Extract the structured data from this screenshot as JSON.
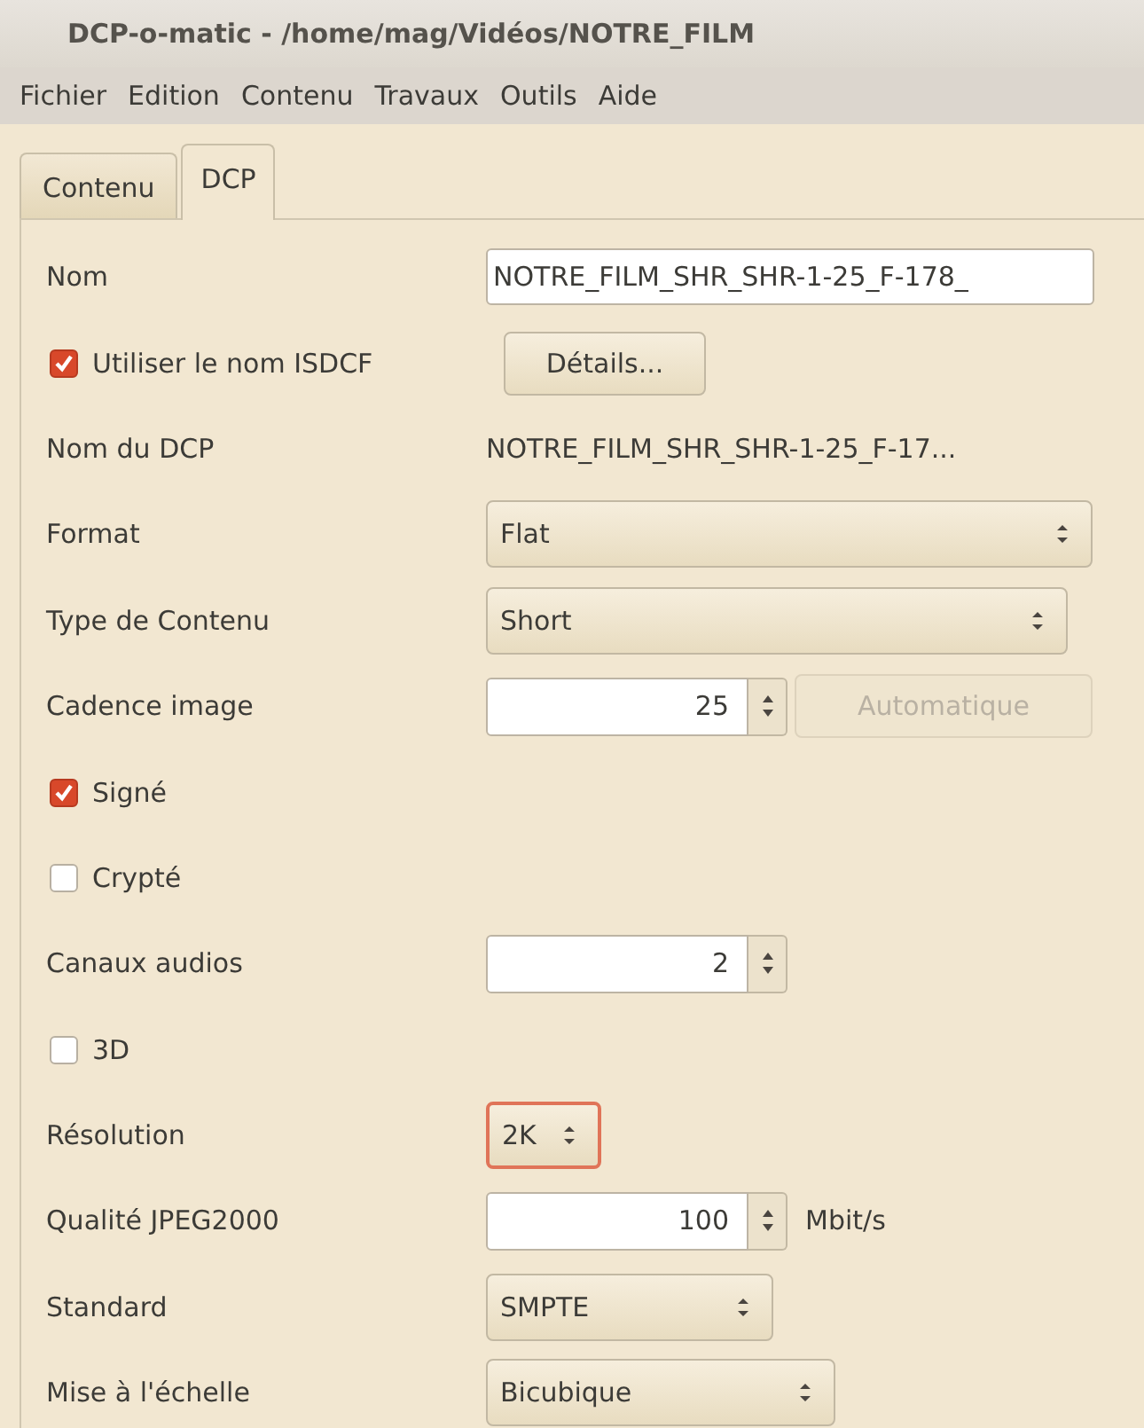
{
  "window": {
    "title": "DCP-o-matic - /home/mag/Vidéos/NOTRE_FILM"
  },
  "menu": [
    "Fichier",
    "Edition",
    "Contenu",
    "Travaux",
    "Outils",
    "Aide"
  ],
  "tabs": [
    {
      "label": "Contenu",
      "selected": false
    },
    {
      "label": "DCP",
      "selected": true
    }
  ],
  "rows": [
    {
      "kind": "text",
      "label": "Nom",
      "value": "NOTRE_FILM_SHR_SHR-1-25_F-178_"
    },
    {
      "kind": "checkbutton",
      "label": "Utiliser le nom ISDCF",
      "checked": true,
      "button": "Détails..."
    },
    {
      "kind": "readout",
      "label": "Nom du DCP",
      "value": "NOTRE_FILM_SHR_SHR-1-25_F-17..."
    },
    {
      "kind": "select",
      "label": "Format",
      "value": "Flat",
      "focused": false
    },
    {
      "kind": "select",
      "label": "Type de Contenu",
      "value": "Short",
      "focused": false
    },
    {
      "kind": "spin",
      "label": "Cadence image",
      "value": "25",
      "button": "Automatique",
      "disabled": true
    },
    {
      "kind": "checkbox",
      "label": "Signé",
      "checked": true
    },
    {
      "kind": "checkbox",
      "label": "Crypté",
      "checked": false
    },
    {
      "kind": "spin",
      "label": "Canaux audios",
      "value": "2"
    },
    {
      "kind": "checkbox",
      "label": "3D",
      "checked": false
    },
    {
      "kind": "select",
      "label": "Résolution",
      "value": "2K",
      "focused": true
    },
    {
      "kind": "spin",
      "label": "Qualité JPEG2000",
      "value": "100",
      "unit": "Mbit/s"
    },
    {
      "kind": "select",
      "label": "Standard",
      "value": "SMPTE",
      "focused": false
    },
    {
      "kind": "select",
      "label": "Mise à l'échelle",
      "value": "Bicubique",
      "focused": false
    }
  ]
}
